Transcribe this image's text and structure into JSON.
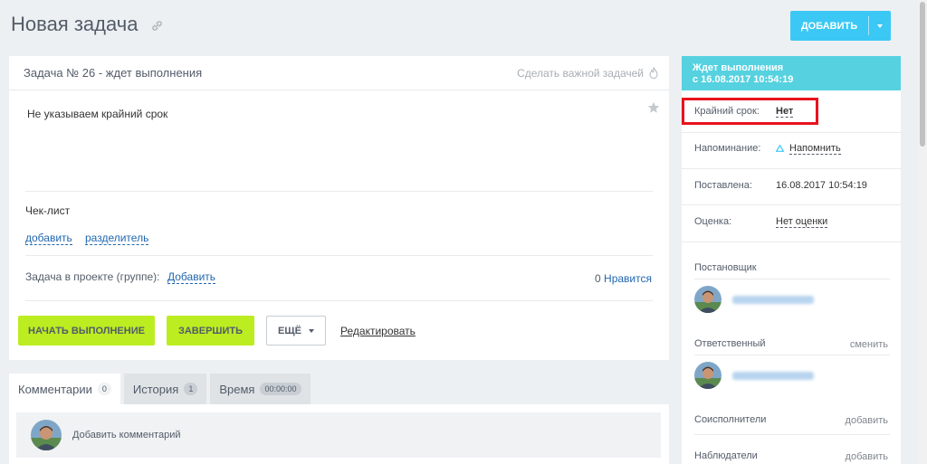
{
  "page": {
    "title": "Новая задача",
    "add_button": "ДОБАВИТЬ"
  },
  "task": {
    "header": "Задача № 26 - ждет выполнения",
    "make_important": "Сделать важной задачей",
    "description": "Не указываем крайний срок",
    "checklist_label": "Чек-лист",
    "checklist_add": "добавить",
    "checklist_separator": "разделитель",
    "project_label": "Задача в проекте (группе):",
    "project_add": "Добавить",
    "likes_count": "0",
    "likes_label": "Нравится"
  },
  "actions": {
    "start": "НАЧАТЬ ВЫПОЛНЕНИЕ",
    "finish": "ЗАВЕРШИТЬ",
    "more": "ЕЩЁ",
    "edit": "Редактировать"
  },
  "tabs": [
    {
      "label": "Комментарии",
      "count": "0"
    },
    {
      "label": "История",
      "count": "1"
    },
    {
      "label": "Время",
      "count": "00:00:00"
    }
  ],
  "comment": {
    "placeholder": "Добавить комментарий"
  },
  "sidebar": {
    "status_line1": "Ждет выполнения",
    "status_line2": "с 16.08.2017 10:54:19",
    "deadline_label": "Крайний срок:",
    "deadline_value": "Нет",
    "reminder_label": "Напоминание:",
    "reminder_value": "Напомнить",
    "created_label": "Поставлена:",
    "created_value": "16.08.2017 10:54:19",
    "rating_label": "Оценка:",
    "rating_value": "Нет оценки",
    "creator_label": "Постановщик",
    "responsible_label": "Ответственный",
    "responsible_change": "сменить",
    "accomplices_label": "Соисполнители",
    "accomplices_add": "добавить",
    "observers_label": "Наблюдатели",
    "observers_add": "добавить"
  },
  "colors": {
    "accent": "#3bc8f5",
    "status": "#56d1e0",
    "action": "#bbed21",
    "highlight": "#e8121e",
    "link": "#2067b0"
  }
}
